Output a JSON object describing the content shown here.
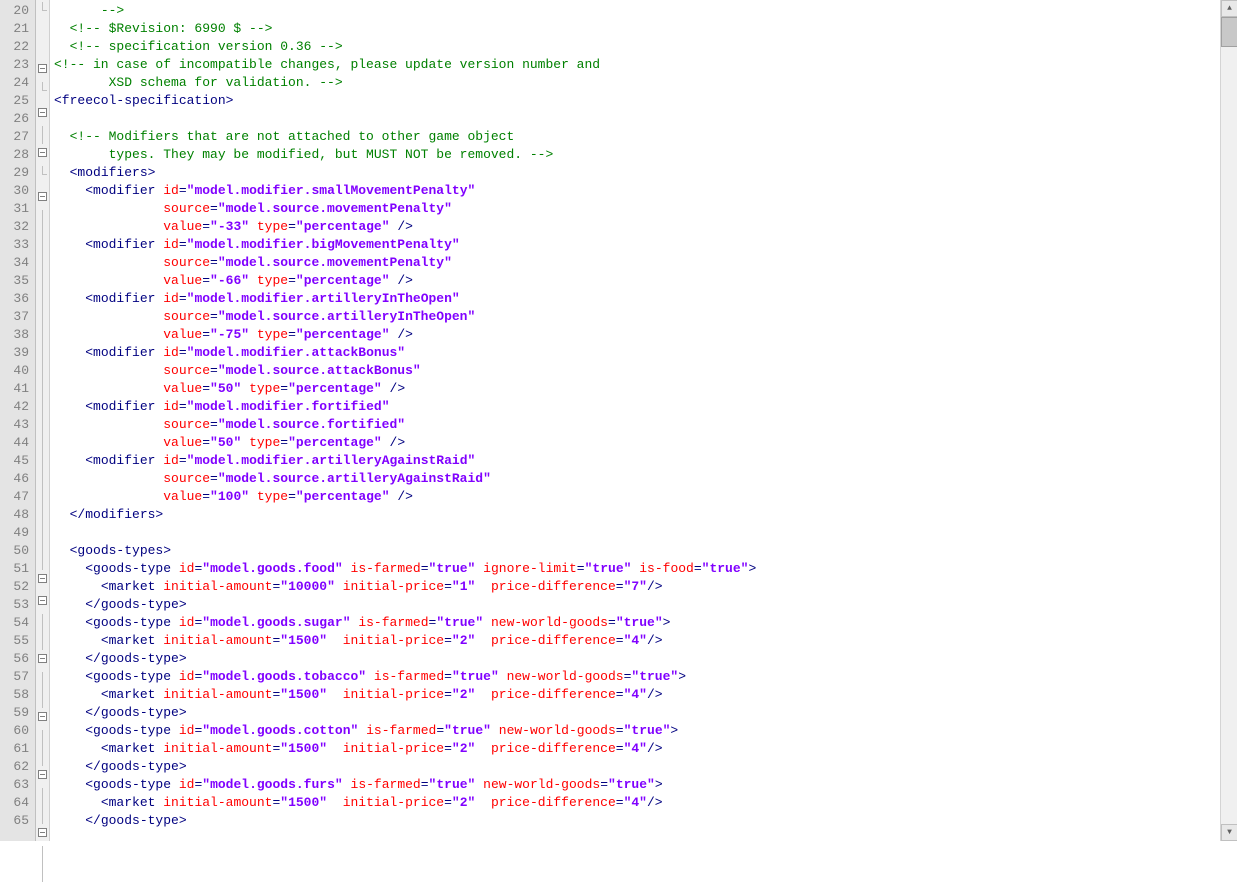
{
  "gutter": {
    "start": 20,
    "end": 65
  },
  "fold": {
    "20": "end",
    "21": "",
    "22": "",
    "23": "open",
    "24": "end",
    "25": "open",
    "26": "line",
    "27": "open",
    "28": "end",
    "29": "open",
    "30": "line",
    "31": "line",
    "32": "line",
    "33": "line",
    "34": "line",
    "35": "line",
    "36": "line",
    "37": "line",
    "38": "line",
    "39": "line",
    "40": "line",
    "41": "line",
    "42": "line",
    "43": "line",
    "44": "line",
    "45": "line",
    "46": "line",
    "47": "line",
    "48": "line",
    "49": "line",
    "50": "open",
    "51": "open",
    "52": "line",
    "53": "line",
    "54": "open",
    "55": "line",
    "56": "line",
    "57": "open",
    "58": "line",
    "59": "line",
    "60": "open",
    "61": "line",
    "62": "line",
    "63": "open",
    "64": "line",
    "65": "line"
  },
  "code": {
    "20": [
      {
        "t": "      ",
        "c": ""
      },
      {
        "t": "-->",
        "c": "c-comment"
      }
    ],
    "21": [
      {
        "t": "  ",
        "c": ""
      },
      {
        "t": "<!-- $Revision: 6990 $ -->",
        "c": "c-comment"
      }
    ],
    "22": [
      {
        "t": "  ",
        "c": ""
      },
      {
        "t": "<!-- specification version 0.36 -->",
        "c": "c-comment"
      }
    ],
    "23": [
      {
        "t": "<!-- in case of incompatible changes, please update version number and",
        "c": "c-comment"
      }
    ],
    "24": [
      {
        "t": "       XSD schema for validation. -->",
        "c": "c-comment"
      }
    ],
    "25": [
      {
        "t": "<freecol-specification>",
        "c": "c-tag"
      }
    ],
    "26": [],
    "27": [
      {
        "t": "  ",
        "c": ""
      },
      {
        "t": "<!-- Modifiers that are not attached to other game object",
        "c": "c-comment"
      }
    ],
    "28": [
      {
        "t": "       types. They may be modified, but MUST NOT be removed. -->",
        "c": "c-comment"
      }
    ],
    "29": [
      {
        "t": "  ",
        "c": ""
      },
      {
        "t": "<modifiers>",
        "c": "c-tag"
      }
    ],
    "30": [
      {
        "t": "    ",
        "c": ""
      },
      {
        "t": "<modifier ",
        "c": "c-tag"
      },
      {
        "t": "id",
        "c": "c-attr"
      },
      {
        "t": "=",
        "c": "c-punct"
      },
      {
        "t": "\"model.modifier.smallMovementPenalty\"",
        "c": "c-string"
      }
    ],
    "31": [
      {
        "t": "              ",
        "c": ""
      },
      {
        "t": "source",
        "c": "c-attr"
      },
      {
        "t": "=",
        "c": "c-punct"
      },
      {
        "t": "\"model.source.movementPenalty\"",
        "c": "c-string"
      }
    ],
    "32": [
      {
        "t": "              ",
        "c": ""
      },
      {
        "t": "value",
        "c": "c-attr"
      },
      {
        "t": "=",
        "c": "c-punct"
      },
      {
        "t": "\"-33\"",
        "c": "c-string"
      },
      {
        "t": " ",
        "c": ""
      },
      {
        "t": "type",
        "c": "c-attr"
      },
      {
        "t": "=",
        "c": "c-punct"
      },
      {
        "t": "\"percentage\"",
        "c": "c-string"
      },
      {
        "t": " />",
        "c": "c-tag"
      }
    ],
    "33": [
      {
        "t": "    ",
        "c": ""
      },
      {
        "t": "<modifier ",
        "c": "c-tag"
      },
      {
        "t": "id",
        "c": "c-attr"
      },
      {
        "t": "=",
        "c": "c-punct"
      },
      {
        "t": "\"model.modifier.bigMovementPenalty\"",
        "c": "c-string"
      }
    ],
    "34": [
      {
        "t": "              ",
        "c": ""
      },
      {
        "t": "source",
        "c": "c-attr"
      },
      {
        "t": "=",
        "c": "c-punct"
      },
      {
        "t": "\"model.source.movementPenalty\"",
        "c": "c-string"
      }
    ],
    "35": [
      {
        "t": "              ",
        "c": ""
      },
      {
        "t": "value",
        "c": "c-attr"
      },
      {
        "t": "=",
        "c": "c-punct"
      },
      {
        "t": "\"-66\"",
        "c": "c-string"
      },
      {
        "t": " ",
        "c": ""
      },
      {
        "t": "type",
        "c": "c-attr"
      },
      {
        "t": "=",
        "c": "c-punct"
      },
      {
        "t": "\"percentage\"",
        "c": "c-string"
      },
      {
        "t": " />",
        "c": "c-tag"
      }
    ],
    "36": [
      {
        "t": "    ",
        "c": ""
      },
      {
        "t": "<modifier ",
        "c": "c-tag"
      },
      {
        "t": "id",
        "c": "c-attr"
      },
      {
        "t": "=",
        "c": "c-punct"
      },
      {
        "t": "\"model.modifier.artilleryInTheOpen\"",
        "c": "c-string"
      }
    ],
    "37": [
      {
        "t": "              ",
        "c": ""
      },
      {
        "t": "source",
        "c": "c-attr"
      },
      {
        "t": "=",
        "c": "c-punct"
      },
      {
        "t": "\"model.source.artilleryInTheOpen\"",
        "c": "c-string"
      }
    ],
    "38": [
      {
        "t": "              ",
        "c": ""
      },
      {
        "t": "value",
        "c": "c-attr"
      },
      {
        "t": "=",
        "c": "c-punct"
      },
      {
        "t": "\"-75\"",
        "c": "c-string"
      },
      {
        "t": " ",
        "c": ""
      },
      {
        "t": "type",
        "c": "c-attr"
      },
      {
        "t": "=",
        "c": "c-punct"
      },
      {
        "t": "\"percentage\"",
        "c": "c-string"
      },
      {
        "t": " />",
        "c": "c-tag"
      }
    ],
    "39": [
      {
        "t": "    ",
        "c": ""
      },
      {
        "t": "<modifier ",
        "c": "c-tag"
      },
      {
        "t": "id",
        "c": "c-attr"
      },
      {
        "t": "=",
        "c": "c-punct"
      },
      {
        "t": "\"model.modifier.attackBonus\"",
        "c": "c-string"
      }
    ],
    "40": [
      {
        "t": "              ",
        "c": ""
      },
      {
        "t": "source",
        "c": "c-attr"
      },
      {
        "t": "=",
        "c": "c-punct"
      },
      {
        "t": "\"model.source.attackBonus\"",
        "c": "c-string"
      }
    ],
    "41": [
      {
        "t": "              ",
        "c": ""
      },
      {
        "t": "value",
        "c": "c-attr"
      },
      {
        "t": "=",
        "c": "c-punct"
      },
      {
        "t": "\"50\"",
        "c": "c-string"
      },
      {
        "t": " ",
        "c": ""
      },
      {
        "t": "type",
        "c": "c-attr"
      },
      {
        "t": "=",
        "c": "c-punct"
      },
      {
        "t": "\"percentage\"",
        "c": "c-string"
      },
      {
        "t": " />",
        "c": "c-tag"
      }
    ],
    "42": [
      {
        "t": "    ",
        "c": ""
      },
      {
        "t": "<modifier ",
        "c": "c-tag"
      },
      {
        "t": "id",
        "c": "c-attr"
      },
      {
        "t": "=",
        "c": "c-punct"
      },
      {
        "t": "\"model.modifier.fortified\"",
        "c": "c-string"
      }
    ],
    "43": [
      {
        "t": "              ",
        "c": ""
      },
      {
        "t": "source",
        "c": "c-attr"
      },
      {
        "t": "=",
        "c": "c-punct"
      },
      {
        "t": "\"model.source.fortified\"",
        "c": "c-string"
      }
    ],
    "44": [
      {
        "t": "              ",
        "c": ""
      },
      {
        "t": "value",
        "c": "c-attr"
      },
      {
        "t": "=",
        "c": "c-punct"
      },
      {
        "t": "\"50\"",
        "c": "c-string"
      },
      {
        "t": " ",
        "c": ""
      },
      {
        "t": "type",
        "c": "c-attr"
      },
      {
        "t": "=",
        "c": "c-punct"
      },
      {
        "t": "\"percentage\"",
        "c": "c-string"
      },
      {
        "t": " />",
        "c": "c-tag"
      }
    ],
    "45": [
      {
        "t": "    ",
        "c": ""
      },
      {
        "t": "<modifier ",
        "c": "c-tag"
      },
      {
        "t": "id",
        "c": "c-attr"
      },
      {
        "t": "=",
        "c": "c-punct"
      },
      {
        "t": "\"model.modifier.artilleryAgainstRaid\"",
        "c": "c-string"
      }
    ],
    "46": [
      {
        "t": "              ",
        "c": ""
      },
      {
        "t": "source",
        "c": "c-attr"
      },
      {
        "t": "=",
        "c": "c-punct"
      },
      {
        "t": "\"model.source.artilleryAgainstRaid\"",
        "c": "c-string"
      }
    ],
    "47": [
      {
        "t": "              ",
        "c": ""
      },
      {
        "t": "value",
        "c": "c-attr"
      },
      {
        "t": "=",
        "c": "c-punct"
      },
      {
        "t": "\"100\"",
        "c": "c-string"
      },
      {
        "t": " ",
        "c": ""
      },
      {
        "t": "type",
        "c": "c-attr"
      },
      {
        "t": "=",
        "c": "c-punct"
      },
      {
        "t": "\"percentage\"",
        "c": "c-string"
      },
      {
        "t": " />",
        "c": "c-tag"
      }
    ],
    "48": [
      {
        "t": "  ",
        "c": ""
      },
      {
        "t": "</modifiers>",
        "c": "c-tag"
      }
    ],
    "49": [],
    "50": [
      {
        "t": "  ",
        "c": ""
      },
      {
        "t": "<goods-types>",
        "c": "c-tag"
      }
    ],
    "51": [
      {
        "t": "    ",
        "c": ""
      },
      {
        "t": "<goods-type ",
        "c": "c-tag"
      },
      {
        "t": "id",
        "c": "c-attr"
      },
      {
        "t": "=",
        "c": "c-punct"
      },
      {
        "t": "\"model.goods.food\"",
        "c": "c-string"
      },
      {
        "t": " ",
        "c": ""
      },
      {
        "t": "is-farmed",
        "c": "c-attr"
      },
      {
        "t": "=",
        "c": "c-punct"
      },
      {
        "t": "\"true\"",
        "c": "c-string"
      },
      {
        "t": " ",
        "c": ""
      },
      {
        "t": "ignore-limit",
        "c": "c-attr"
      },
      {
        "t": "=",
        "c": "c-punct"
      },
      {
        "t": "\"true\"",
        "c": "c-string"
      },
      {
        "t": " ",
        "c": ""
      },
      {
        "t": "is-food",
        "c": "c-attr"
      },
      {
        "t": "=",
        "c": "c-punct"
      },
      {
        "t": "\"true\"",
        "c": "c-string"
      },
      {
        "t": ">",
        "c": "c-tag"
      }
    ],
    "52": [
      {
        "t": "      ",
        "c": ""
      },
      {
        "t": "<market ",
        "c": "c-tag"
      },
      {
        "t": "initial-amount",
        "c": "c-attr"
      },
      {
        "t": "=",
        "c": "c-punct"
      },
      {
        "t": "\"10000\"",
        "c": "c-string"
      },
      {
        "t": " ",
        "c": ""
      },
      {
        "t": "initial-price",
        "c": "c-attr"
      },
      {
        "t": "=",
        "c": "c-punct"
      },
      {
        "t": "\"1\"",
        "c": "c-string"
      },
      {
        "t": "  ",
        "c": ""
      },
      {
        "t": "price-difference",
        "c": "c-attr"
      },
      {
        "t": "=",
        "c": "c-punct"
      },
      {
        "t": "\"7\"",
        "c": "c-string"
      },
      {
        "t": "/>",
        "c": "c-tag"
      }
    ],
    "53": [
      {
        "t": "    ",
        "c": ""
      },
      {
        "t": "</goods-type>",
        "c": "c-tag"
      }
    ],
    "54": [
      {
        "t": "    ",
        "c": ""
      },
      {
        "t": "<goods-type ",
        "c": "c-tag"
      },
      {
        "t": "id",
        "c": "c-attr"
      },
      {
        "t": "=",
        "c": "c-punct"
      },
      {
        "t": "\"model.goods.sugar\"",
        "c": "c-string"
      },
      {
        "t": " ",
        "c": ""
      },
      {
        "t": "is-farmed",
        "c": "c-attr"
      },
      {
        "t": "=",
        "c": "c-punct"
      },
      {
        "t": "\"true\"",
        "c": "c-string"
      },
      {
        "t": " ",
        "c": ""
      },
      {
        "t": "new-world-goods",
        "c": "c-attr"
      },
      {
        "t": "=",
        "c": "c-punct"
      },
      {
        "t": "\"true\"",
        "c": "c-string"
      },
      {
        "t": ">",
        "c": "c-tag"
      }
    ],
    "55": [
      {
        "t": "      ",
        "c": ""
      },
      {
        "t": "<market ",
        "c": "c-tag"
      },
      {
        "t": "initial-amount",
        "c": "c-attr"
      },
      {
        "t": "=",
        "c": "c-punct"
      },
      {
        "t": "\"1500\"",
        "c": "c-string"
      },
      {
        "t": "  ",
        "c": ""
      },
      {
        "t": "initial-price",
        "c": "c-attr"
      },
      {
        "t": "=",
        "c": "c-punct"
      },
      {
        "t": "\"2\"",
        "c": "c-string"
      },
      {
        "t": "  ",
        "c": ""
      },
      {
        "t": "price-difference",
        "c": "c-attr"
      },
      {
        "t": "=",
        "c": "c-punct"
      },
      {
        "t": "\"4\"",
        "c": "c-string"
      },
      {
        "t": "/>",
        "c": "c-tag"
      }
    ],
    "56": [
      {
        "t": "    ",
        "c": ""
      },
      {
        "t": "</goods-type>",
        "c": "c-tag"
      }
    ],
    "57": [
      {
        "t": "    ",
        "c": ""
      },
      {
        "t": "<goods-type ",
        "c": "c-tag"
      },
      {
        "t": "id",
        "c": "c-attr"
      },
      {
        "t": "=",
        "c": "c-punct"
      },
      {
        "t": "\"model.goods.tobacco\"",
        "c": "c-string"
      },
      {
        "t": " ",
        "c": ""
      },
      {
        "t": "is-farmed",
        "c": "c-attr"
      },
      {
        "t": "=",
        "c": "c-punct"
      },
      {
        "t": "\"true\"",
        "c": "c-string"
      },
      {
        "t": " ",
        "c": ""
      },
      {
        "t": "new-world-goods",
        "c": "c-attr"
      },
      {
        "t": "=",
        "c": "c-punct"
      },
      {
        "t": "\"true\"",
        "c": "c-string"
      },
      {
        "t": ">",
        "c": "c-tag"
      }
    ],
    "58": [
      {
        "t": "      ",
        "c": ""
      },
      {
        "t": "<market ",
        "c": "c-tag"
      },
      {
        "t": "initial-amount",
        "c": "c-attr"
      },
      {
        "t": "=",
        "c": "c-punct"
      },
      {
        "t": "\"1500\"",
        "c": "c-string"
      },
      {
        "t": "  ",
        "c": ""
      },
      {
        "t": "initial-price",
        "c": "c-attr"
      },
      {
        "t": "=",
        "c": "c-punct"
      },
      {
        "t": "\"2\"",
        "c": "c-string"
      },
      {
        "t": "  ",
        "c": ""
      },
      {
        "t": "price-difference",
        "c": "c-attr"
      },
      {
        "t": "=",
        "c": "c-punct"
      },
      {
        "t": "\"4\"",
        "c": "c-string"
      },
      {
        "t": "/>",
        "c": "c-tag"
      }
    ],
    "59": [
      {
        "t": "    ",
        "c": ""
      },
      {
        "t": "</goods-type>",
        "c": "c-tag"
      }
    ],
    "60": [
      {
        "t": "    ",
        "c": ""
      },
      {
        "t": "<goods-type ",
        "c": "c-tag"
      },
      {
        "t": "id",
        "c": "c-attr"
      },
      {
        "t": "=",
        "c": "c-punct"
      },
      {
        "t": "\"model.goods.cotton\"",
        "c": "c-string"
      },
      {
        "t": " ",
        "c": ""
      },
      {
        "t": "is-farmed",
        "c": "c-attr"
      },
      {
        "t": "=",
        "c": "c-punct"
      },
      {
        "t": "\"true\"",
        "c": "c-string"
      },
      {
        "t": " ",
        "c": ""
      },
      {
        "t": "new-world-goods",
        "c": "c-attr"
      },
      {
        "t": "=",
        "c": "c-punct"
      },
      {
        "t": "\"true\"",
        "c": "c-string"
      },
      {
        "t": ">",
        "c": "c-tag"
      }
    ],
    "61": [
      {
        "t": "      ",
        "c": ""
      },
      {
        "t": "<market ",
        "c": "c-tag"
      },
      {
        "t": "initial-amount",
        "c": "c-attr"
      },
      {
        "t": "=",
        "c": "c-punct"
      },
      {
        "t": "\"1500\"",
        "c": "c-string"
      },
      {
        "t": "  ",
        "c": ""
      },
      {
        "t": "initial-price",
        "c": "c-attr"
      },
      {
        "t": "=",
        "c": "c-punct"
      },
      {
        "t": "\"2\"",
        "c": "c-string"
      },
      {
        "t": "  ",
        "c": ""
      },
      {
        "t": "price-difference",
        "c": "c-attr"
      },
      {
        "t": "=",
        "c": "c-punct"
      },
      {
        "t": "\"4\"",
        "c": "c-string"
      },
      {
        "t": "/>",
        "c": "c-tag"
      }
    ],
    "62": [
      {
        "t": "    ",
        "c": ""
      },
      {
        "t": "</goods-type>",
        "c": "c-tag"
      }
    ],
    "63": [
      {
        "t": "    ",
        "c": ""
      },
      {
        "t": "<goods-type ",
        "c": "c-tag"
      },
      {
        "t": "id",
        "c": "c-attr"
      },
      {
        "t": "=",
        "c": "c-punct"
      },
      {
        "t": "\"model.goods.furs\"",
        "c": "c-string"
      },
      {
        "t": " ",
        "c": ""
      },
      {
        "t": "is-farmed",
        "c": "c-attr"
      },
      {
        "t": "=",
        "c": "c-punct"
      },
      {
        "t": "\"true\"",
        "c": "c-string"
      },
      {
        "t": " ",
        "c": ""
      },
      {
        "t": "new-world-goods",
        "c": "c-attr"
      },
      {
        "t": "=",
        "c": "c-punct"
      },
      {
        "t": "\"true\"",
        "c": "c-string"
      },
      {
        "t": ">",
        "c": "c-tag"
      }
    ],
    "64": [
      {
        "t": "      ",
        "c": ""
      },
      {
        "t": "<market ",
        "c": "c-tag"
      },
      {
        "t": "initial-amount",
        "c": "c-attr"
      },
      {
        "t": "=",
        "c": "c-punct"
      },
      {
        "t": "\"1500\"",
        "c": "c-string"
      },
      {
        "t": "  ",
        "c": ""
      },
      {
        "t": "initial-price",
        "c": "c-attr"
      },
      {
        "t": "=",
        "c": "c-punct"
      },
      {
        "t": "\"2\"",
        "c": "c-string"
      },
      {
        "t": "  ",
        "c": ""
      },
      {
        "t": "price-difference",
        "c": "c-attr"
      },
      {
        "t": "=",
        "c": "c-punct"
      },
      {
        "t": "\"4\"",
        "c": "c-string"
      },
      {
        "t": "/>",
        "c": "c-tag"
      }
    ],
    "65": [
      {
        "t": "    ",
        "c": ""
      },
      {
        "t": "</goods-type>",
        "c": "c-tag"
      }
    ]
  }
}
